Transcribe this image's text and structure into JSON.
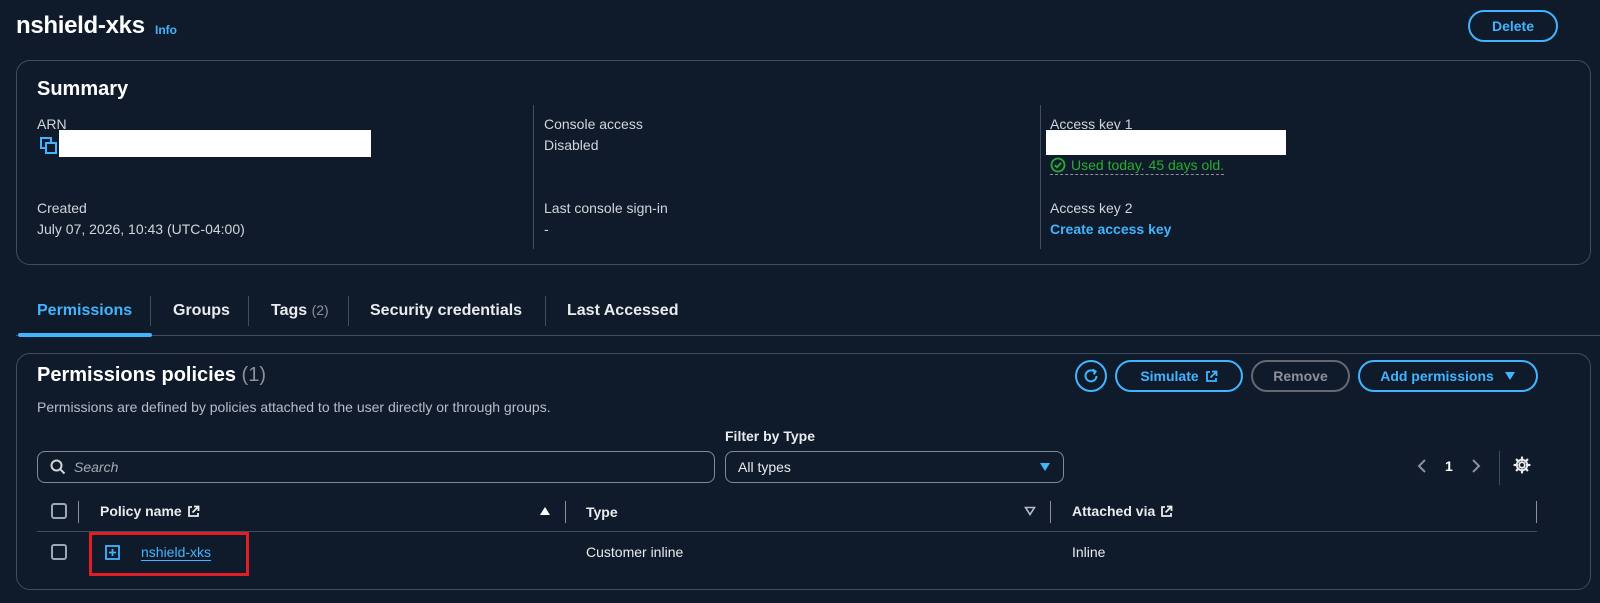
{
  "header": {
    "title": "nshield-xks",
    "info_label": "Info",
    "delete_label": "Delete"
  },
  "summary": {
    "title": "Summary",
    "arn_label": "ARN",
    "created_label": "Created",
    "created_value": "July 07, 2026, 10:43 (UTC-04:00)",
    "console_access_label": "Console access",
    "console_access_value": "Disabled",
    "last_signin_label": "Last console sign-in",
    "last_signin_value": "-",
    "access_key1_label": "Access key 1",
    "access_key1_status": "Used today. 45 days old.",
    "access_key2_label": "Access key 2",
    "create_access_key_label": "Create access key"
  },
  "tabs": [
    {
      "label": "Permissions"
    },
    {
      "label": "Groups"
    },
    {
      "label": "Tags",
      "count": "(2)"
    },
    {
      "label": "Security credentials"
    },
    {
      "label": "Last Accessed"
    }
  ],
  "permissions": {
    "title": "Permissions policies",
    "count": "(1)",
    "description": "Permissions are defined by policies attached to the user directly or through groups.",
    "simulate_label": "Simulate",
    "remove_label": "Remove",
    "add_permissions_label": "Add permissions",
    "search_placeholder": "Search",
    "filter_label": "Filter by Type",
    "filter_value": "All types",
    "page_number": "1",
    "columns": {
      "policy_name": "Policy name",
      "type": "Type",
      "attached_via": "Attached via"
    },
    "rows": [
      {
        "policy_name": "nshield-xks",
        "type": "Customer inline",
        "attached_via": "Inline"
      }
    ]
  },
  "colors": {
    "background": "#0f1b2a",
    "accent": "#42b4ff",
    "success": "#29ad32",
    "highlight": "#e11d26"
  }
}
